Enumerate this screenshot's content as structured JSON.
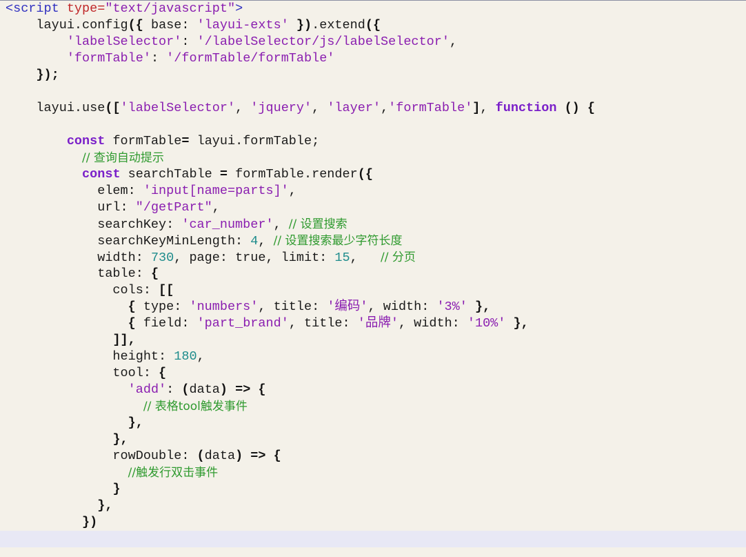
{
  "editor": {
    "lines": [
      [
        {
          "t": "tag",
          "v": "<script "
        },
        {
          "t": "attr",
          "v": "type="
        },
        {
          "t": "str",
          "v": "\"text/javascript\""
        },
        {
          "t": "tag",
          "v": ">"
        }
      ],
      [
        {
          "t": "id",
          "v": "    layui.config"
        },
        {
          "t": "pun",
          "v": "({"
        },
        {
          "t": "id",
          "v": " base: "
        },
        {
          "t": "str",
          "v": "'layui-exts'"
        },
        {
          "t": "pun",
          "v": " })"
        },
        {
          "t": "id",
          "v": ".extend"
        },
        {
          "t": "pun",
          "v": "({"
        }
      ],
      [
        {
          "t": "id",
          "v": "        "
        },
        {
          "t": "str",
          "v": "'labelSelector'"
        },
        {
          "t": "id",
          "v": ": "
        },
        {
          "t": "str",
          "v": "'/labelSelector/js/labelSelector'"
        },
        {
          "t": "id",
          "v": ","
        }
      ],
      [
        {
          "t": "id",
          "v": "        "
        },
        {
          "t": "str",
          "v": "'formTable'"
        },
        {
          "t": "id",
          "v": ": "
        },
        {
          "t": "str",
          "v": "'/formTable/formTable'"
        }
      ],
      [
        {
          "t": "pun",
          "v": "    });"
        }
      ],
      [],
      [
        {
          "t": "id",
          "v": "    layui.use"
        },
        {
          "t": "pun",
          "v": "(["
        },
        {
          "t": "str",
          "v": "'labelSelector'"
        },
        {
          "t": "id",
          "v": ", "
        },
        {
          "t": "str",
          "v": "'jquery'"
        },
        {
          "t": "id",
          "v": ", "
        },
        {
          "t": "str",
          "v": "'layer'"
        },
        {
          "t": "id",
          "v": ","
        },
        {
          "t": "str",
          "v": "'formTable'"
        },
        {
          "t": "pun",
          "v": "]"
        },
        {
          "t": "id",
          "v": ", "
        },
        {
          "t": "kw",
          "v": "function"
        },
        {
          "t": "id",
          "v": " "
        },
        {
          "t": "pun",
          "v": "() {"
        }
      ],
      [],
      [
        {
          "t": "id",
          "v": "        "
        },
        {
          "t": "kw",
          "v": "const"
        },
        {
          "t": "id",
          "v": " formTable"
        },
        {
          "t": "pun",
          "v": "="
        },
        {
          "t": "id",
          "v": " layui.formTable;"
        }
      ],
      [
        {
          "t": "id",
          "v": "          "
        },
        {
          "t": "com",
          "v": "// 查询自动提示"
        }
      ],
      [
        {
          "t": "id",
          "v": "          "
        },
        {
          "t": "kw",
          "v": "const"
        },
        {
          "t": "id",
          "v": " searchTable "
        },
        {
          "t": "pun",
          "v": "="
        },
        {
          "t": "id",
          "v": " formTable.render"
        },
        {
          "t": "pun",
          "v": "({"
        }
      ],
      [
        {
          "t": "id",
          "v": "            elem: "
        },
        {
          "t": "str",
          "v": "'input[name=parts]'"
        },
        {
          "t": "id",
          "v": ","
        }
      ],
      [
        {
          "t": "id",
          "v": "            url: "
        },
        {
          "t": "str",
          "v": "\"/getPart\""
        },
        {
          "t": "id",
          "v": ","
        }
      ],
      [
        {
          "t": "id",
          "v": "            searchKey: "
        },
        {
          "t": "str",
          "v": "'car_number'"
        },
        {
          "t": "id",
          "v": ", "
        },
        {
          "t": "com",
          "v": "// 设置搜索"
        }
      ],
      [
        {
          "t": "id",
          "v": "            searchKeyMinLength: "
        },
        {
          "t": "num",
          "v": "4"
        },
        {
          "t": "id",
          "v": ", "
        },
        {
          "t": "com",
          "v": "// 设置搜索最少字符长度"
        }
      ],
      [
        {
          "t": "id",
          "v": "            width: "
        },
        {
          "t": "num",
          "v": "730"
        },
        {
          "t": "id",
          "v": ", page: true, limit: "
        },
        {
          "t": "num",
          "v": "15"
        },
        {
          "t": "id",
          "v": ",   "
        },
        {
          "t": "com",
          "v": "// 分页"
        }
      ],
      [
        {
          "t": "id",
          "v": "            table: "
        },
        {
          "t": "pun",
          "v": "{"
        }
      ],
      [
        {
          "t": "id",
          "v": "              cols: "
        },
        {
          "t": "pun",
          "v": "[["
        }
      ],
      [
        {
          "t": "id",
          "v": "                "
        },
        {
          "t": "pun",
          "v": "{"
        },
        {
          "t": "id",
          "v": " type: "
        },
        {
          "t": "str",
          "v": "'numbers'"
        },
        {
          "t": "id",
          "v": ", title: "
        },
        {
          "t": "str",
          "v": "'编码'"
        },
        {
          "t": "id",
          "v": ", width: "
        },
        {
          "t": "str",
          "v": "'3%'"
        },
        {
          "t": "id",
          "v": " "
        },
        {
          "t": "pun",
          "v": "},"
        }
      ],
      [
        {
          "t": "id",
          "v": "                "
        },
        {
          "t": "pun",
          "v": "{"
        },
        {
          "t": "id",
          "v": " field: "
        },
        {
          "t": "str",
          "v": "'part_brand'"
        },
        {
          "t": "id",
          "v": ", title: "
        },
        {
          "t": "str",
          "v": "'品牌'"
        },
        {
          "t": "id",
          "v": ", width: "
        },
        {
          "t": "str",
          "v": "'10%'"
        },
        {
          "t": "id",
          "v": " "
        },
        {
          "t": "pun",
          "v": "},"
        }
      ],
      [
        {
          "t": "id",
          "v": "              "
        },
        {
          "t": "pun",
          "v": "]],"
        }
      ],
      [
        {
          "t": "id",
          "v": "              height: "
        },
        {
          "t": "num",
          "v": "180"
        },
        {
          "t": "id",
          "v": ","
        }
      ],
      [
        {
          "t": "id",
          "v": "              tool: "
        },
        {
          "t": "pun",
          "v": "{"
        }
      ],
      [
        {
          "t": "id",
          "v": "                "
        },
        {
          "t": "str",
          "v": "'add'"
        },
        {
          "t": "id",
          "v": ": "
        },
        {
          "t": "pun",
          "v": "("
        },
        {
          "t": "id",
          "v": "data"
        },
        {
          "t": "pun",
          "v": ") => {"
        }
      ],
      [
        {
          "t": "id",
          "v": "                  "
        },
        {
          "t": "com",
          "v": "// 表格tool触发事件"
        }
      ],
      [
        {
          "t": "id",
          "v": "                "
        },
        {
          "t": "pun",
          "v": "},"
        }
      ],
      [
        {
          "t": "id",
          "v": "              "
        },
        {
          "t": "pun",
          "v": "},"
        }
      ],
      [
        {
          "t": "id",
          "v": "              rowDouble: "
        },
        {
          "t": "pun",
          "v": "("
        },
        {
          "t": "id",
          "v": "data"
        },
        {
          "t": "pun",
          "v": ") => {"
        }
      ],
      [
        {
          "t": "id",
          "v": "                "
        },
        {
          "t": "com",
          "v": "//触发行双击事件"
        }
      ],
      [
        {
          "t": "id",
          "v": "              "
        },
        {
          "t": "pun",
          "v": "}"
        }
      ],
      [
        {
          "t": "id",
          "v": "            "
        },
        {
          "t": "pun",
          "v": "},"
        }
      ],
      [
        {
          "t": "id",
          "v": "          "
        },
        {
          "t": "pun",
          "v": "})"
        }
      ],
      []
    ],
    "current_line": 32
  }
}
